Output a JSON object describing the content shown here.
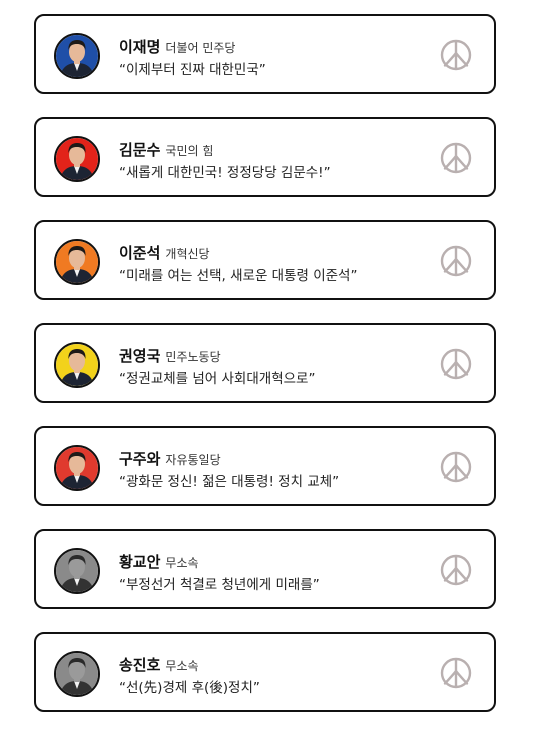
{
  "candidates": [
    {
      "name": "이재명",
      "party": "더불어 민주당",
      "slogan": "“이제부터 진짜 대한민국”",
      "color": "#1f4fa8",
      "stamp_icon": "vote-stamp-icon"
    },
    {
      "name": "김문수",
      "party": "국민의 힘",
      "slogan": "“새롭게 대한민국! 정정당당 김문수!”",
      "color": "#e2231a",
      "stamp_icon": "vote-stamp-icon"
    },
    {
      "name": "이준석",
      "party": "개혁신당",
      "slogan": "“미래를 여는 선택, 새로운 대통령 이준석”",
      "color": "#f07a22",
      "stamp_icon": "vote-stamp-icon"
    },
    {
      "name": "권영국",
      "party": "민주노동당",
      "slogan": "“정권교체를 넘어 사회대개혁으로”",
      "color": "#f2d21b",
      "stamp_icon": "vote-stamp-icon"
    },
    {
      "name": "구주와",
      "party": "자유통일당",
      "slogan": "“광화문 정신! 젊은 대통령! 정치 교체”",
      "color": "#e03a2e",
      "stamp_icon": "vote-stamp-icon"
    },
    {
      "name": "황교안",
      "party": "무소속",
      "slogan": "“부정선거 척결로 청년에게 미래를”",
      "color": "#8a8a8a",
      "stamp_icon": "vote-stamp-icon"
    },
    {
      "name": "송진호",
      "party": "무소속",
      "slogan": "“선(先)경제 후(後)정치”",
      "color": "#8a8a8a",
      "stamp_icon": "vote-stamp-icon"
    }
  ],
  "colors": {
    "border": "#111111",
    "stamp": "#b9b0b0"
  }
}
